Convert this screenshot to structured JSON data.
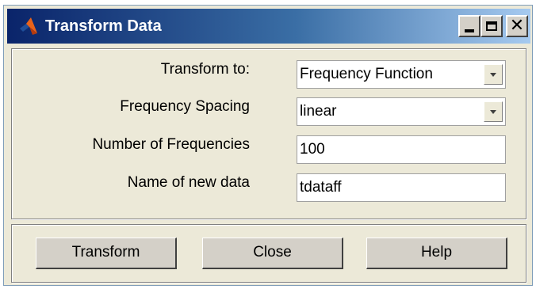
{
  "window": {
    "title": "Transform Data"
  },
  "form": {
    "transform_to": {
      "label": "Transform to:",
      "value": "Frequency Function"
    },
    "frequency_spacing": {
      "label": "Frequency Spacing",
      "value": "linear"
    },
    "number_of_frequencies": {
      "label": "Number of Frequencies",
      "value": "100"
    },
    "name_of_new_data": {
      "label": "Name of new data",
      "value": "tdataff"
    }
  },
  "buttons": {
    "transform": "Transform",
    "close": "Close",
    "help": "Help"
  },
  "icons": {
    "app": "matlab-logo-icon",
    "minimize": "minimize-icon",
    "maximize": "maximize-icon",
    "close": "close-icon",
    "dropdown": "chevron-down-icon"
  }
}
